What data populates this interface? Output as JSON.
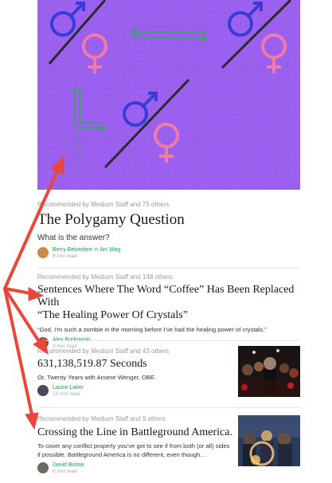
{
  "stories": [
    {
      "rec": "Recommended by Medium Staff and 75 others",
      "title": "The Polygamy Question",
      "subtitle": "What is the answer?",
      "author": "Berry Belvedere",
      "in_word": "in",
      "publication": "Arc Mag",
      "read": "6 min read"
    },
    {
      "rec": "Recommended by Medium Staff and 148 others",
      "title_lines": [
        "Sentences Where The Word “Coffee” Has Been Replaced With",
        "“The Healing Power Of Crystals”"
      ],
      "snippet": "“God, I’m such a zombie in the morning before I’ve had the healing power of crystals.”",
      "author": "Alex Borkowski",
      "read": "3 min read"
    },
    {
      "rec": "Recommended by Medium Staff and 43 others",
      "title": "631,138,519.87 Seconds",
      "snippet": "Or, Twenty Years with Arsene Wenger, OBE.",
      "author": "Laurie Laker",
      "read": "12 min read"
    },
    {
      "rec": "Recommended by Medium Staff and 9 others",
      "title": "Crossing the Line in Battleground America.",
      "snippet_lines": [
        "To cover any conflict properly you’ve got to see if from both (or all) sides",
        "if possible. Battleground America is no different, even though…"
      ],
      "author": "David Butow",
      "read": "6 min read"
    }
  ],
  "colors": {
    "hero_bg": "#9b5ff0",
    "male": "#3a3ad6",
    "female": "#f07aa8",
    "arrow": "#e8473a",
    "green": "#2fa84f"
  }
}
